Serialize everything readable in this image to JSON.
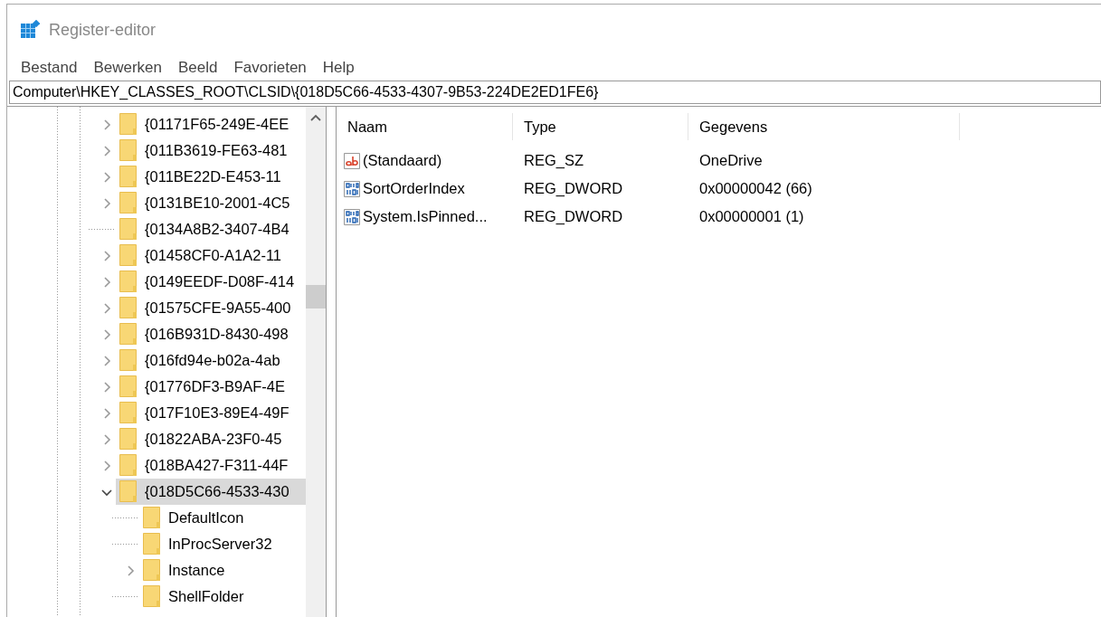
{
  "window": {
    "title": "Register-editor"
  },
  "menu": [
    "Bestand",
    "Bewerken",
    "Beeld",
    "Favorieten",
    "Help"
  ],
  "address": "Computer\\HKEY_CLASSES_ROOT\\CLSID\\{018D5C66-4533-4307-9B53-224DE2ED1FE6}",
  "tree": [
    {
      "label": "{01171F65-249E-4EE",
      "expandable": true,
      "expanded": false,
      "selected": false
    },
    {
      "label": "{011B3619-FE63-481",
      "expandable": true,
      "expanded": false,
      "selected": false
    },
    {
      "label": "{011BE22D-E453-11",
      "expandable": true,
      "expanded": false,
      "selected": false
    },
    {
      "label": "{0131BE10-2001-4C5",
      "expandable": true,
      "expanded": false,
      "selected": false
    },
    {
      "label": "{0134A8B2-3407-4B4",
      "expandable": false,
      "selected": false
    },
    {
      "label": "{01458CF0-A1A2-11",
      "expandable": true,
      "expanded": false,
      "selected": false
    },
    {
      "label": "{0149EEDF-D08F-414",
      "expandable": true,
      "expanded": false,
      "selected": false
    },
    {
      "label": "{01575CFE-9A55-400",
      "expandable": true,
      "expanded": false,
      "selected": false
    },
    {
      "label": "{016B931D-8430-498",
      "expandable": true,
      "expanded": false,
      "selected": false
    },
    {
      "label": "{016fd94e-b02a-4ab",
      "expandable": true,
      "expanded": false,
      "selected": false
    },
    {
      "label": "{01776DF3-B9AF-4E",
      "expandable": true,
      "expanded": false,
      "selected": false
    },
    {
      "label": "{017F10E3-89E4-49F",
      "expandable": true,
      "expanded": false,
      "selected": false
    },
    {
      "label": "{01822ABA-23F0-45",
      "expandable": true,
      "expanded": false,
      "selected": false
    },
    {
      "label": "{018BA427-F311-44F",
      "expandable": true,
      "expanded": false,
      "selected": false
    },
    {
      "label": "{018D5C66-4533-430",
      "expandable": true,
      "expanded": true,
      "selected": true,
      "children": [
        {
          "label": "DefaultIcon",
          "expandable": false,
          "selected": false
        },
        {
          "label": "InProcServer32",
          "expandable": false,
          "selected": false
        },
        {
          "label": "Instance",
          "expandable": true,
          "expanded": false,
          "selected": false
        },
        {
          "label": "ShellFolder",
          "expandable": false,
          "selected": false
        }
      ]
    }
  ],
  "table": {
    "columns": [
      "Naam",
      "Type",
      "Gegevens"
    ],
    "rows": [
      {
        "kind": "string",
        "name": "(Standaard)",
        "type": "REG_SZ",
        "data": "OneDrive"
      },
      {
        "kind": "dword",
        "name": "SortOrderIndex",
        "type": "REG_DWORD",
        "data": "0x00000042 (66)"
      },
      {
        "kind": "dword",
        "name": "System.IsPinned...",
        "type": "REG_DWORD",
        "data": "0x00000001 (1)"
      }
    ]
  }
}
